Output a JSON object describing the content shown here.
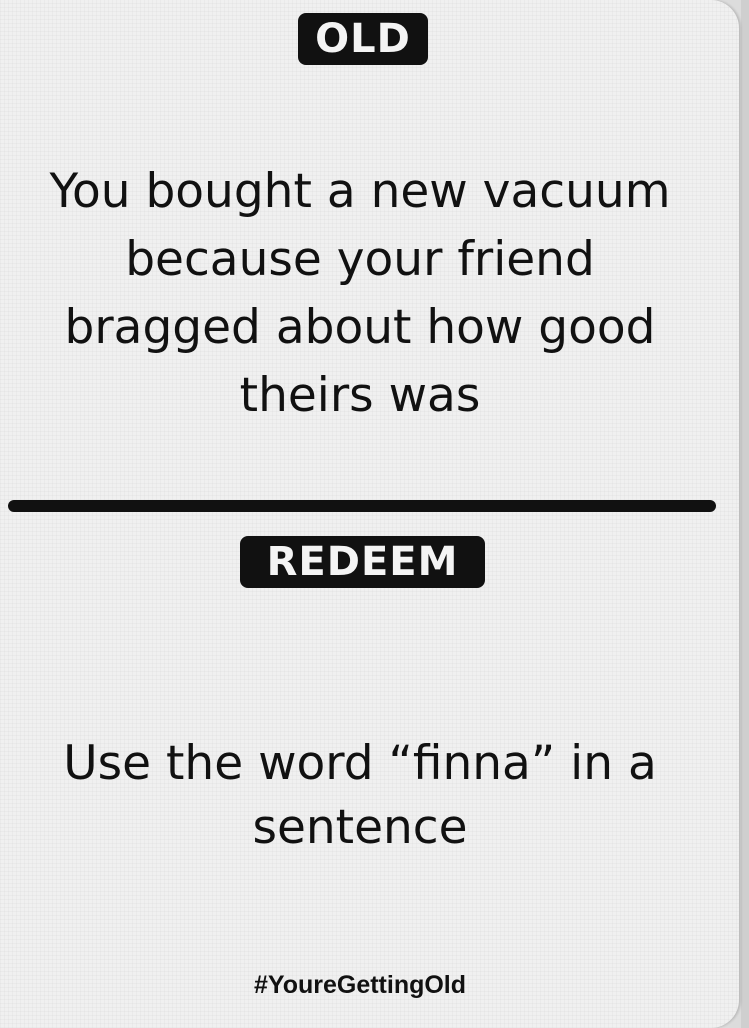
{
  "card": {
    "old_label": "OLD",
    "old_text": "You bought a new vacuum because your friend bragged about how good theirs was",
    "redeem_label": "REDEEM",
    "redeem_text": "Use the word “finna” in a sentence",
    "hashtag": "#YoureGettingOld"
  }
}
